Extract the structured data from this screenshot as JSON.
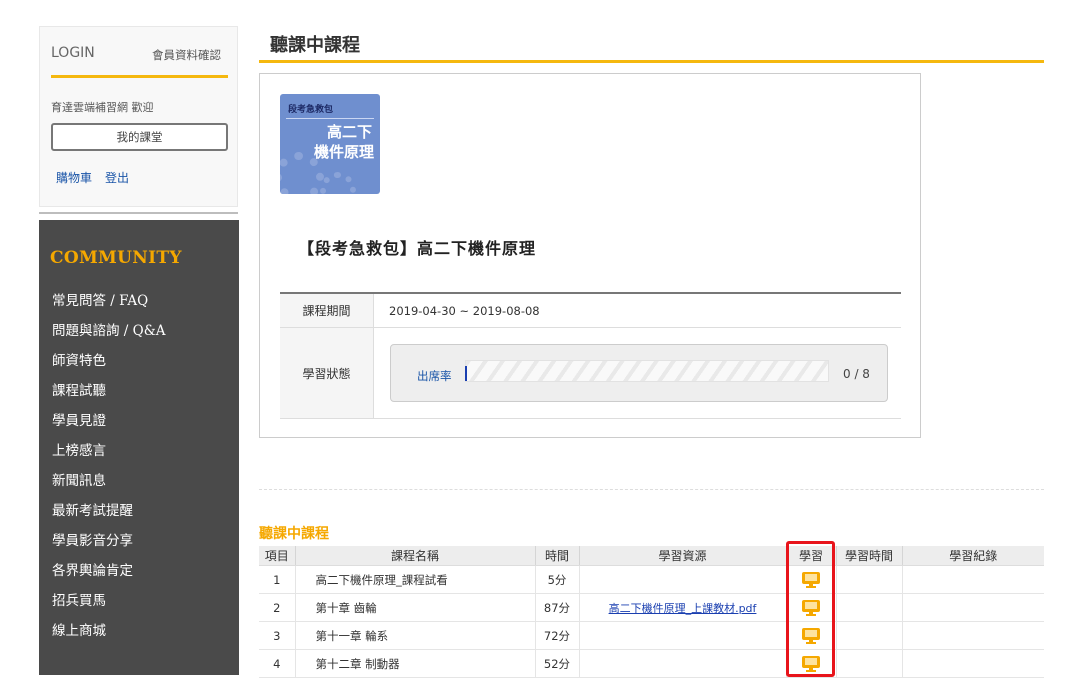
{
  "login": {
    "title": "LOGIN",
    "member_link": "會員資料確認",
    "welcome": "育達雲端補習網 歡迎",
    "my_class_button": "我的課堂",
    "cart_link": "購物車",
    "logout_link": "登出"
  },
  "community": {
    "title": "COMMUNITY",
    "items": [
      "常見問答 / FAQ",
      "問題與諮詢 / Q&A",
      "師資特色",
      "課程試聽",
      "學員見證",
      "上榜感言",
      "新聞訊息",
      "最新考試提醒",
      "學員影音分享",
      "各界輿論肯定",
      "招兵買馬",
      "線上商城"
    ]
  },
  "page_title": "聽課中課程",
  "course": {
    "thumb_tag": "段考急救包",
    "thumb_line1": "高二下",
    "thumb_line2": "機件原理",
    "name": "【段考急救包】高二下機件原理",
    "period_label": "課程期間",
    "period_value": "2019-04-30 ~ 2019-08-08",
    "status_label": "學習狀態",
    "attendance_label": "出席率",
    "attendance_fraction": 0,
    "attendance_count": "0 / 8"
  },
  "section_title": "聽課中課程",
  "lessons": {
    "headers": [
      "項目",
      "課程名稱",
      "時間",
      "學習資源",
      "學習",
      "學習時間",
      "學習紀錄"
    ],
    "rows": [
      {
        "no": "1",
        "name": "高二下機件原理_課程試看",
        "time": "5分",
        "resource": "",
        "study_time": "",
        "record": ""
      },
      {
        "no": "2",
        "name": "第十章 齒輪",
        "time": "87分",
        "resource": "高二下機件原理_上課教材.pdf",
        "study_time": "",
        "record": ""
      },
      {
        "no": "3",
        "name": "第十一章 輪系",
        "time": "72分",
        "resource": "",
        "study_time": "",
        "record": ""
      },
      {
        "no": "4",
        "name": "第十二章 制動器",
        "time": "52分",
        "resource": "",
        "study_time": "",
        "record": ""
      }
    ]
  },
  "colors": {
    "accent": "#f5b80f",
    "community_bg": "#4a4a4a",
    "highlight": "#e8141b",
    "link": "#1a55a8"
  },
  "icons": {
    "study": "monitor-icon"
  }
}
